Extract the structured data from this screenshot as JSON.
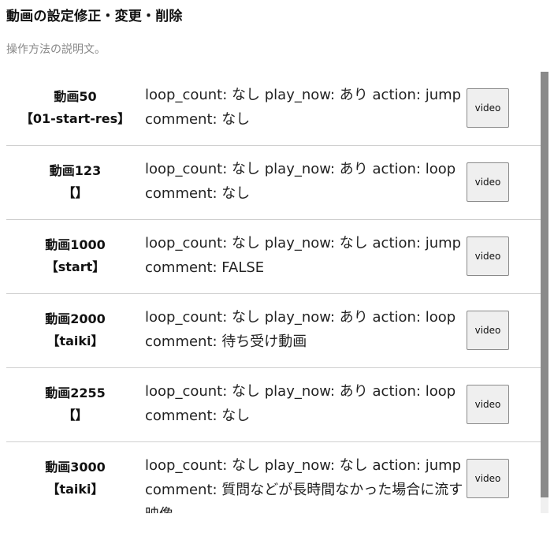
{
  "page": {
    "title": "動画の設定修正・変更・削除",
    "description": "操作方法の説明文。"
  },
  "rows": [
    {
      "name": "動画50",
      "tag": "【01-start-res】",
      "desc": "loop_count: なし play_now: あり action: jump comment: なし",
      "button": "video"
    },
    {
      "name": "動画123",
      "tag": "【】",
      "desc": "loop_count: なし play_now: あり action: loop comment: なし",
      "button": "video"
    },
    {
      "name": "動画1000",
      "tag": "【start】",
      "desc": "loop_count: なし play_now: なし action: jump comment: FALSE",
      "button": "video"
    },
    {
      "name": "動画2000",
      "tag": "【taiki】",
      "desc": "loop_count: なし play_now: あり action: loop comment: 待ち受け動画",
      "button": "video"
    },
    {
      "name": "動画2255",
      "tag": "【】",
      "desc": "loop_count: なし play_now: あり action: loop comment: なし",
      "button": "video"
    },
    {
      "name": "動画3000",
      "tag": "【taiki】",
      "desc": "loop_count: なし play_now: なし action: jump comment: 質問などが長時間なかった場合に流す映像",
      "button": "video"
    }
  ]
}
